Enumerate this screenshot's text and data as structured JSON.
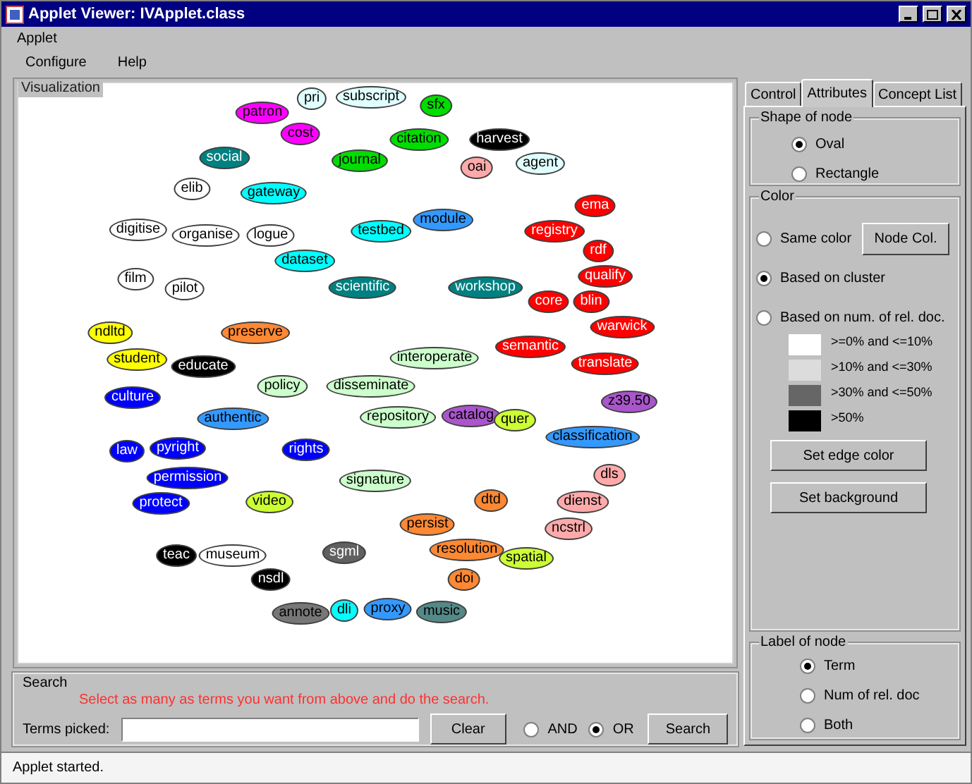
{
  "window": {
    "title": "Applet Viewer: IVApplet.class"
  },
  "applet_menu": "Applet",
  "menubar": [
    "Configure",
    "Help"
  ],
  "visualization": {
    "title": "Visualization",
    "nodes": [
      {
        "label": "pri",
        "color": "#e0ffff"
      },
      {
        "label": "subscript",
        "color": "#e0ffff"
      },
      {
        "label": "sfx",
        "color": "#00dd00"
      },
      {
        "label": "patron",
        "color": "#ff00ff"
      },
      {
        "label": "cost",
        "color": "#ff00ff"
      },
      {
        "label": "citation",
        "color": "#00dd00"
      },
      {
        "label": "harvest",
        "color": "#000000"
      },
      {
        "label": "social",
        "color": "#008080"
      },
      {
        "label": "journal",
        "color": "#00dd00"
      },
      {
        "label": "oai",
        "color": "#ffaaaa"
      },
      {
        "label": "agent",
        "color": "#e0ffff"
      },
      {
        "label": "elib",
        "color": "#ffffff"
      },
      {
        "label": "gateway",
        "color": "#00ffff"
      },
      {
        "label": "ema",
        "color": "#ff0000"
      },
      {
        "label": "module",
        "color": "#3399ff"
      },
      {
        "label": "digitise",
        "color": "#ffffff"
      },
      {
        "label": "organise",
        "color": "#ffffff"
      },
      {
        "label": "logue",
        "color": "#ffffff"
      },
      {
        "label": "testbed",
        "color": "#00ffff"
      },
      {
        "label": "registry",
        "color": "#ff0000"
      },
      {
        "label": "rdf",
        "color": "#ff0000"
      },
      {
        "label": "dataset",
        "color": "#00ffff"
      },
      {
        "label": "film",
        "color": "#ffffff"
      },
      {
        "label": "pilot",
        "color": "#ffffff"
      },
      {
        "label": "scientific",
        "color": "#008080"
      },
      {
        "label": "workshop",
        "color": "#008080"
      },
      {
        "label": "qualify",
        "color": "#ff0000"
      },
      {
        "label": "core",
        "color": "#ff0000"
      },
      {
        "label": "blin",
        "color": "#ff0000"
      },
      {
        "label": "warwick",
        "color": "#ff0000"
      },
      {
        "label": "ndltd",
        "color": "#ffff00"
      },
      {
        "label": "preserve",
        "color": "#ff8833"
      },
      {
        "label": "semantic",
        "color": "#ff0000"
      },
      {
        "label": "student",
        "color": "#ffff00"
      },
      {
        "label": "educate",
        "color": "#000000"
      },
      {
        "label": "interoperate",
        "color": "#ccffcc"
      },
      {
        "label": "translate",
        "color": "#ff0000"
      },
      {
        "label": "policy",
        "color": "#ccffcc"
      },
      {
        "label": "disseminate",
        "color": "#ccffcc"
      },
      {
        "label": "culture",
        "color": "#0000ff"
      },
      {
        "label": "z39.50",
        "color": "#aa55cc"
      },
      {
        "label": "authentic",
        "color": "#3399ff"
      },
      {
        "label": "repository",
        "color": "#ccffcc"
      },
      {
        "label": "catalog",
        "color": "#aa55cc"
      },
      {
        "label": "quer",
        "color": "#ccff33"
      },
      {
        "label": "classification",
        "color": "#3399ff"
      },
      {
        "label": "law",
        "color": "#0000ff"
      },
      {
        "label": "pyright",
        "color": "#0000ff"
      },
      {
        "label": "rights",
        "color": "#0000ff"
      },
      {
        "label": "permission",
        "color": "#0000ff"
      },
      {
        "label": "signature",
        "color": "#ccffcc"
      },
      {
        "label": "dls",
        "color": "#ffaaaa"
      },
      {
        "label": "protect",
        "color": "#0000ff"
      },
      {
        "label": "video",
        "color": "#ccff33"
      },
      {
        "label": "dtd",
        "color": "#ff8833"
      },
      {
        "label": "dienst",
        "color": "#ffaaaa"
      },
      {
        "label": "persist",
        "color": "#ff8833"
      },
      {
        "label": "ncstrl",
        "color": "#ffaaaa"
      },
      {
        "label": "teac",
        "color": "#000000"
      },
      {
        "label": "museum",
        "color": "#ffffff"
      },
      {
        "label": "sgml",
        "color": "#606060"
      },
      {
        "label": "resolution",
        "color": "#ff8833"
      },
      {
        "label": "spatial",
        "color": "#ccff33"
      },
      {
        "label": "nsdl",
        "color": "#000000"
      },
      {
        "label": "doi",
        "color": "#ff8833"
      },
      {
        "label": "annote",
        "color": "#777777"
      },
      {
        "label": "dli",
        "color": "#00ffff"
      },
      {
        "label": "proxy",
        "color": "#3399ff"
      },
      {
        "label": "music",
        "color": "#558888"
      }
    ]
  },
  "search": {
    "title": "Search",
    "hint": "Select as many as terms you want from above and do the search.",
    "terms_label": "Terms picked:",
    "clear_button": "Clear",
    "modes": [
      {
        "label": "AND",
        "selected": false
      },
      {
        "label": "OR",
        "selected": true
      }
    ],
    "search_button": "Search"
  },
  "tabs": [
    {
      "label": "Control",
      "selected": false
    },
    {
      "label": "Attributes",
      "selected": true
    },
    {
      "label": "Concept List",
      "selected": false
    }
  ],
  "shape_of_node": {
    "title": "Shape of node",
    "options": [
      {
        "label": "Oval",
        "selected": true
      },
      {
        "label": "Rectangle",
        "selected": false
      }
    ]
  },
  "color": {
    "title": "Color",
    "options": [
      {
        "label": "Same color",
        "selected": false
      },
      {
        "label": "Based on cluster",
        "selected": true
      },
      {
        "label": "Based on num. of rel. doc.",
        "selected": false
      }
    ],
    "node_color_button": "Node Col.",
    "legend": [
      {
        "label": ">=0% and <=10%",
        "color": "#ffffff"
      },
      {
        "label": ">10% and <=30%",
        "color": "#dcdcdc"
      },
      {
        "label": ">30% and <=50%",
        "color": "#666666"
      },
      {
        "label": ">50%",
        "color": "#000000"
      }
    ],
    "buttons": [
      "Set edge color",
      "Set background"
    ]
  },
  "label_of_node": {
    "title": "Label of node",
    "options": [
      {
        "label": "Term",
        "selected": true
      },
      {
        "label": "Num of rel. doc",
        "selected": false
      },
      {
        "label": "Both",
        "selected": false
      }
    ]
  },
  "status_bar": "Applet started."
}
